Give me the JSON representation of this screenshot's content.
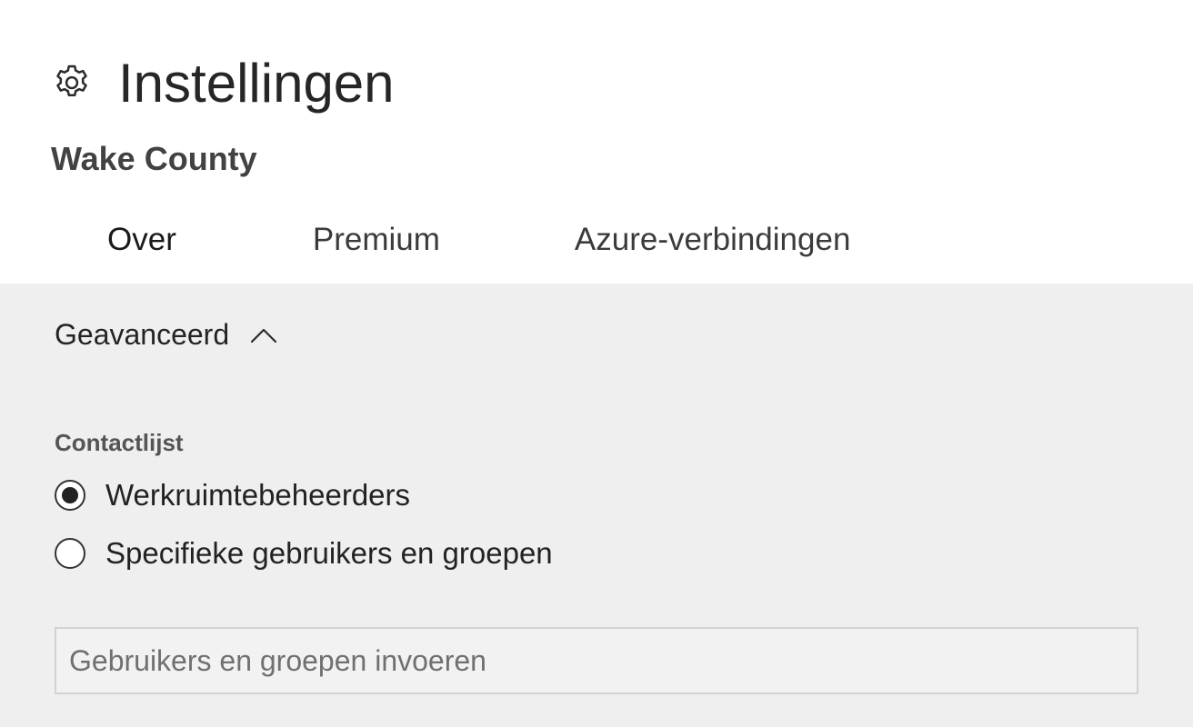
{
  "page": {
    "title": "Instellingen",
    "title_icon": "gear-icon",
    "workspace_name": "Wake County"
  },
  "tabs": [
    {
      "label": "Over",
      "active": true
    },
    {
      "label": "Premium",
      "active": false
    },
    {
      "label": "Azure-verbindingen",
      "active": false
    }
  ],
  "advanced": {
    "label": "Geavanceerd",
    "expanded": true,
    "toggle_icon": "chevron-up-icon"
  },
  "contact_list": {
    "label": "Contactlijst",
    "options": [
      {
        "label": "Werkruimtebeheerders",
        "selected": true
      },
      {
        "label": "Specifieke gebruikers en groepen",
        "selected": false
      }
    ],
    "input": {
      "value": "",
      "placeholder": "Gebruikers en groepen invoeren"
    }
  },
  "colors": {
    "header_background": "#ffffff",
    "panel_background": "#efefef",
    "text": "#222222"
  }
}
